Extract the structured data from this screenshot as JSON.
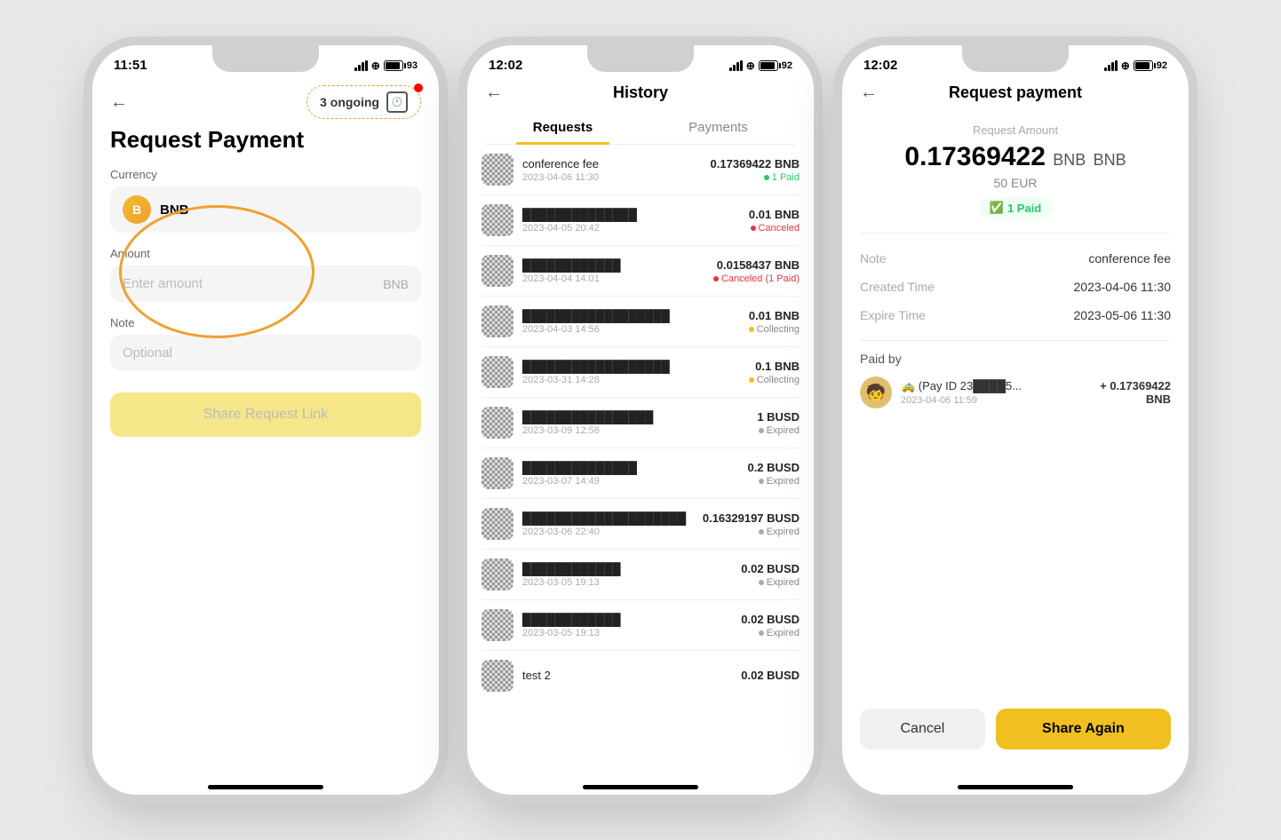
{
  "phone1": {
    "time": "11:51",
    "battery": "93",
    "title": "Request Payment",
    "ongoing_label": "3 ongoing",
    "currency_label": "Currency",
    "currency_name": "BNB",
    "amount_label": "Amount",
    "amount_placeholder": "Enter amount",
    "amount_unit": "BNB",
    "note_label": "Note",
    "note_placeholder": "Optional",
    "share_button": "Share Request Link"
  },
  "phone2": {
    "time": "12:02",
    "battery": "92",
    "title": "History",
    "tab_requests": "Requests",
    "tab_payments": "Payments",
    "items": [
      {
        "name": "conference fee",
        "date": "2023-04-06 11:30",
        "amount": "0.17369422 BNB",
        "status": "1 Paid",
        "status_type": "paid"
      },
      {
        "name": "██████████████",
        "date": "2023-04-05 20:42",
        "amount": "0.01 BNB",
        "status": "Canceled",
        "status_type": "canceled"
      },
      {
        "name": "████████████",
        "date": "2023-04-04 14:01",
        "amount": "0.0158437 BNB",
        "status": "Canceled (1 Paid)",
        "status_type": "canceled"
      },
      {
        "name": "██████████████████",
        "date": "2023-04-03 14:56",
        "amount": "0.01 BNB",
        "status": "Collecting",
        "status_type": "collecting"
      },
      {
        "name": "██████████████████",
        "date": "2023-03-31 14:28",
        "amount": "0.1 BNB",
        "status": "Collecting",
        "status_type": "collecting"
      },
      {
        "name": "████████████████",
        "date": "2023-03-09 12:58",
        "amount": "1 BUSD",
        "status": "Expired",
        "status_type": "expired"
      },
      {
        "name": "██████████████",
        "date": "2023-03-07 14:49",
        "amount": "0.2 BUSD",
        "status": "Expired",
        "status_type": "expired"
      },
      {
        "name": "████████████████████",
        "date": "2023-03-06 22:40",
        "amount": "0.16329197 BUSD",
        "status": "Expired",
        "status_type": "expired"
      },
      {
        "name": "████████████",
        "date": "2023-03-05 19:13",
        "amount": "0.02 BUSD",
        "status": "Expired",
        "status_type": "expired"
      },
      {
        "name": "████████████",
        "date": "2023-03-05 19:13",
        "amount": "0.02 BUSD",
        "status": "Expired",
        "status_type": "expired"
      },
      {
        "name": "test 2",
        "date": "",
        "amount": "0.02 BUSD",
        "status": "",
        "status_type": ""
      }
    ]
  },
  "phone3": {
    "time": "12:02",
    "battery": "92",
    "title": "Request payment",
    "req_amount_label": "Request Amount",
    "amount": "0.17369422",
    "amount_unit": "BNB",
    "fiat_amount": "50 EUR",
    "paid_status": "1 Paid",
    "note_key": "Note",
    "note_val": "conference fee",
    "created_key": "Created Time",
    "created_val": "2023-04-06 11:30",
    "expire_key": "Expire Time",
    "expire_val": "2023-05-06 11:30",
    "paid_by_label": "Paid by",
    "payer_name": "🚕 (Pay ID 23████5...",
    "payer_date": "2023-04-06 11:59",
    "payer_amount": "+ 0.17369422",
    "payer_unit": "BNB",
    "cancel_btn": "Cancel",
    "share_btn": "Share Again"
  }
}
